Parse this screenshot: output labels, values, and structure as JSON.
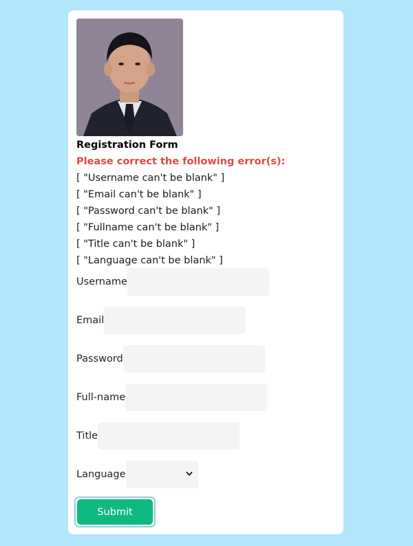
{
  "form": {
    "title": "Registration Form",
    "error_heading": "Please correct the following error(s):",
    "errors": [
      "[ \"Username can't be blank\" ]",
      "[ \"Email can't be blank\" ]",
      "[ \"Password can't be blank\" ]",
      "[ \"Fullname can't be blank\" ]",
      "[ \"Title can't be blank\" ]",
      "[ \"Language can't be blank\" ]"
    ],
    "fields": {
      "username": {
        "label": "Username",
        "value": ""
      },
      "email": {
        "label": "Email",
        "value": ""
      },
      "password": {
        "label": "Password",
        "value": ""
      },
      "fullname": {
        "label": "Full-name",
        "value": ""
      },
      "title": {
        "label": "Title",
        "value": ""
      },
      "language": {
        "label": "Language",
        "selected": ""
      }
    },
    "submit_label": "Submit"
  },
  "colors": {
    "page_background": "#b3e5fc",
    "card_background": "#ffffff",
    "error_text": "#e04848",
    "input_background": "#f3f4f6",
    "submit_background": "#10b981",
    "submit_focus_ring": "#8fcde0"
  },
  "icons": {
    "select_arrow": "chevron-down-icon"
  }
}
